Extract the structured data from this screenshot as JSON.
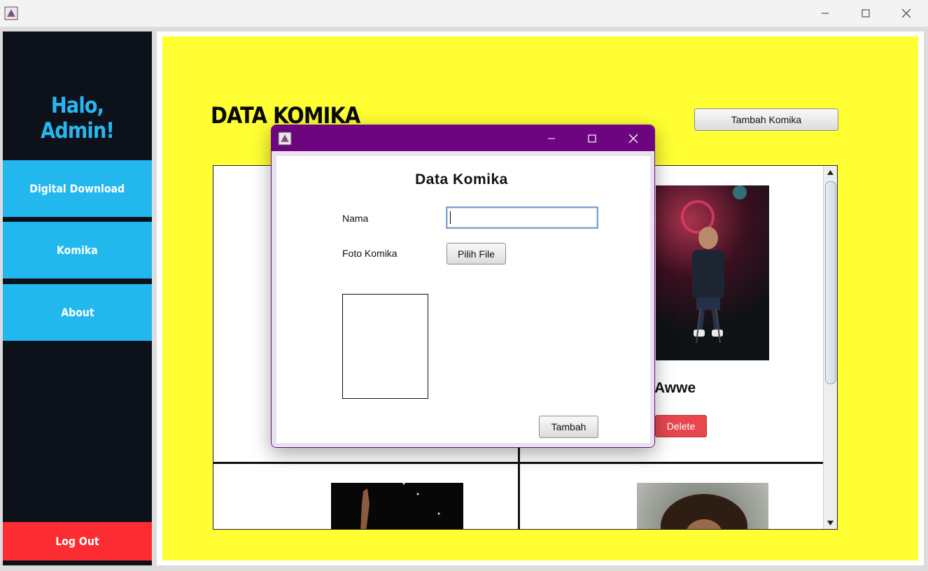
{
  "window": {
    "controls": {
      "minimize_icon": "minimize-icon",
      "maximize_icon": "maximize-icon",
      "close_icon": "close-icon"
    }
  },
  "sidebar": {
    "greeting": "Halo, Admin!",
    "items": [
      {
        "label": "Digital Download"
      },
      {
        "label": "Komika"
      },
      {
        "label": "About"
      }
    ],
    "logout_label": "Log Out"
  },
  "main": {
    "title": "DATA KOMIKA",
    "add_button_label": "Tambah Komika",
    "cards": [
      {
        "name_partial": "Awwe",
        "delete_label": "Delete"
      }
    ]
  },
  "dialog": {
    "heading": "Data Komika",
    "fields": {
      "nama_label": "Nama",
      "nama_value": "",
      "foto_label": "Foto Komika",
      "pilih_file_label": "Pilih File"
    },
    "submit_label": "Tambah"
  },
  "colors": {
    "sidebar_bg": "#0d111a",
    "accent_blue": "#22b8ee",
    "logout_red": "#fb2d32",
    "content_yellow": "#ffff33",
    "dialog_titlebar": "#6e0580",
    "delete_red": "#e8474e"
  }
}
